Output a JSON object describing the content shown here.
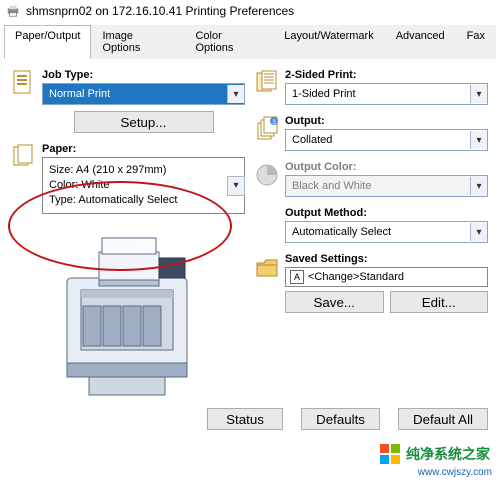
{
  "window": {
    "title": "shmsnprn02 on 172.16.10.41 Printing Preferences"
  },
  "tabs": [
    "Paper/Output",
    "Image Options",
    "Color Options",
    "Layout/Watermark",
    "Advanced",
    "Fax"
  ],
  "left": {
    "jobType": {
      "label": "Job Type:",
      "value": "Normal Print",
      "setup": "Setup..."
    },
    "paper": {
      "label": "Paper:",
      "size": "Size: A4 (210 x 297mm)",
      "color": "Color: White",
      "type": "Type: Automatically Select"
    }
  },
  "right": {
    "sided": {
      "label": "2-Sided Print:",
      "value": "1-Sided Print"
    },
    "output": {
      "label": "Output:",
      "value": "Collated"
    },
    "outputColor": {
      "label": "Output Color:",
      "value": "Black and White"
    },
    "outputMethod": {
      "label": "Output Method:",
      "value": "Automatically Select"
    },
    "saved": {
      "label": "Saved Settings:",
      "value": "<Change>Standard",
      "save": "Save...",
      "edit": "Edit..."
    }
  },
  "bottom": {
    "status": "Status",
    "defaults": "Defaults",
    "defAll": "Default All"
  },
  "watermark": {
    "text": "纯净系统之家",
    "url": "www.cwjszy.com"
  }
}
